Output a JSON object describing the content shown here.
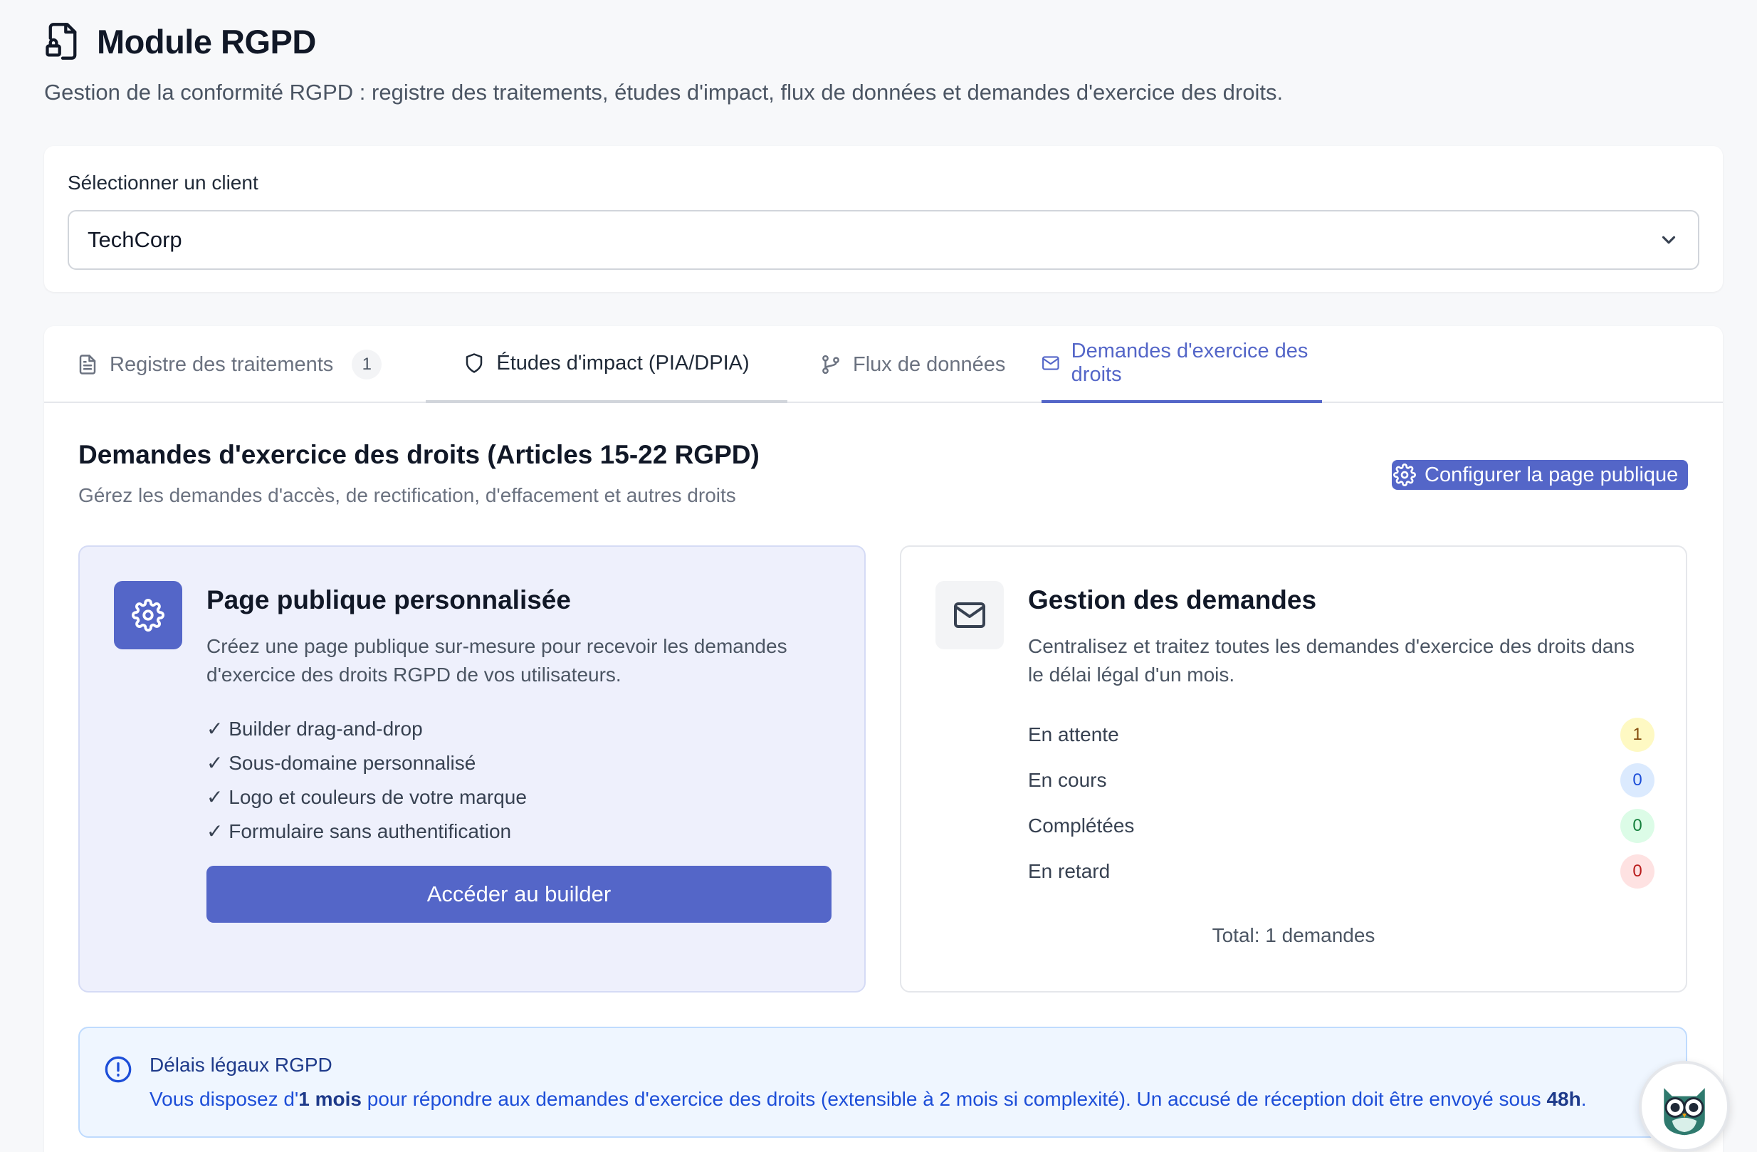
{
  "header": {
    "title": "Module RGPD",
    "subtitle": "Gestion de la conformité RGPD : registre des traitements, études d'impact, flux de données et demandes d'exercice des droits."
  },
  "client": {
    "label": "Sélectionner un client",
    "selected": "TechCorp"
  },
  "tabs": [
    {
      "label": "Registre des traitements",
      "badge": "1",
      "icon": "document-icon"
    },
    {
      "label": "Études d'impact (PIA/DPIA)",
      "icon": "shield-icon"
    },
    {
      "label": "Flux de données",
      "icon": "git-branch-icon"
    },
    {
      "label": "Demandes d'exercice des droits",
      "icon": "mail-icon",
      "active": true
    }
  ],
  "section": {
    "title": "Demandes d'exercice des droits (Articles 15-22 RGPD)",
    "description": "Gérez les demandes d'accès, de rectification, d'effacement et autres droits",
    "config_button": "Configurer la page publique"
  },
  "public_page": {
    "title": "Page publique personnalisée",
    "description": "Créez une page publique sur-mesure pour recevoir les demandes d'exercice des droits RGPD de vos utilisateurs.",
    "features": [
      "Builder drag-and-drop",
      "Sous-domaine personnalisé",
      "Logo et couleurs de votre marque",
      "Formulaire sans authentification"
    ],
    "button": "Accéder au builder"
  },
  "requests": {
    "title": "Gestion des demandes",
    "description": "Centralisez et traitez toutes les demandes d'exercice des droits dans le délai légal d'un mois.",
    "stats": [
      {
        "label": "En attente",
        "count": "1",
        "color": "#fef9c3"
      },
      {
        "label": "En cours",
        "count": "0",
        "color": "#dbeafe"
      },
      {
        "label": "Complétées",
        "count": "0",
        "color": "#dcfce7"
      },
      {
        "label": "En retard",
        "count": "0",
        "color": "#fee2e2"
      }
    ],
    "total": "Total: 1 demandes"
  },
  "info": {
    "title": "Délais légaux RGPD",
    "text_1": "Vous disposez d'",
    "bold_1": "1 mois",
    "text_2": " pour répondre aux demandes d'exercice des droits (extensible à 2 mois si complexité). Un accusé de réception doit être envoyé sous ",
    "bold_2": "48h",
    "text_3": "."
  },
  "colors": {
    "accent": "#5466c8",
    "background": "#f7f8fa"
  }
}
